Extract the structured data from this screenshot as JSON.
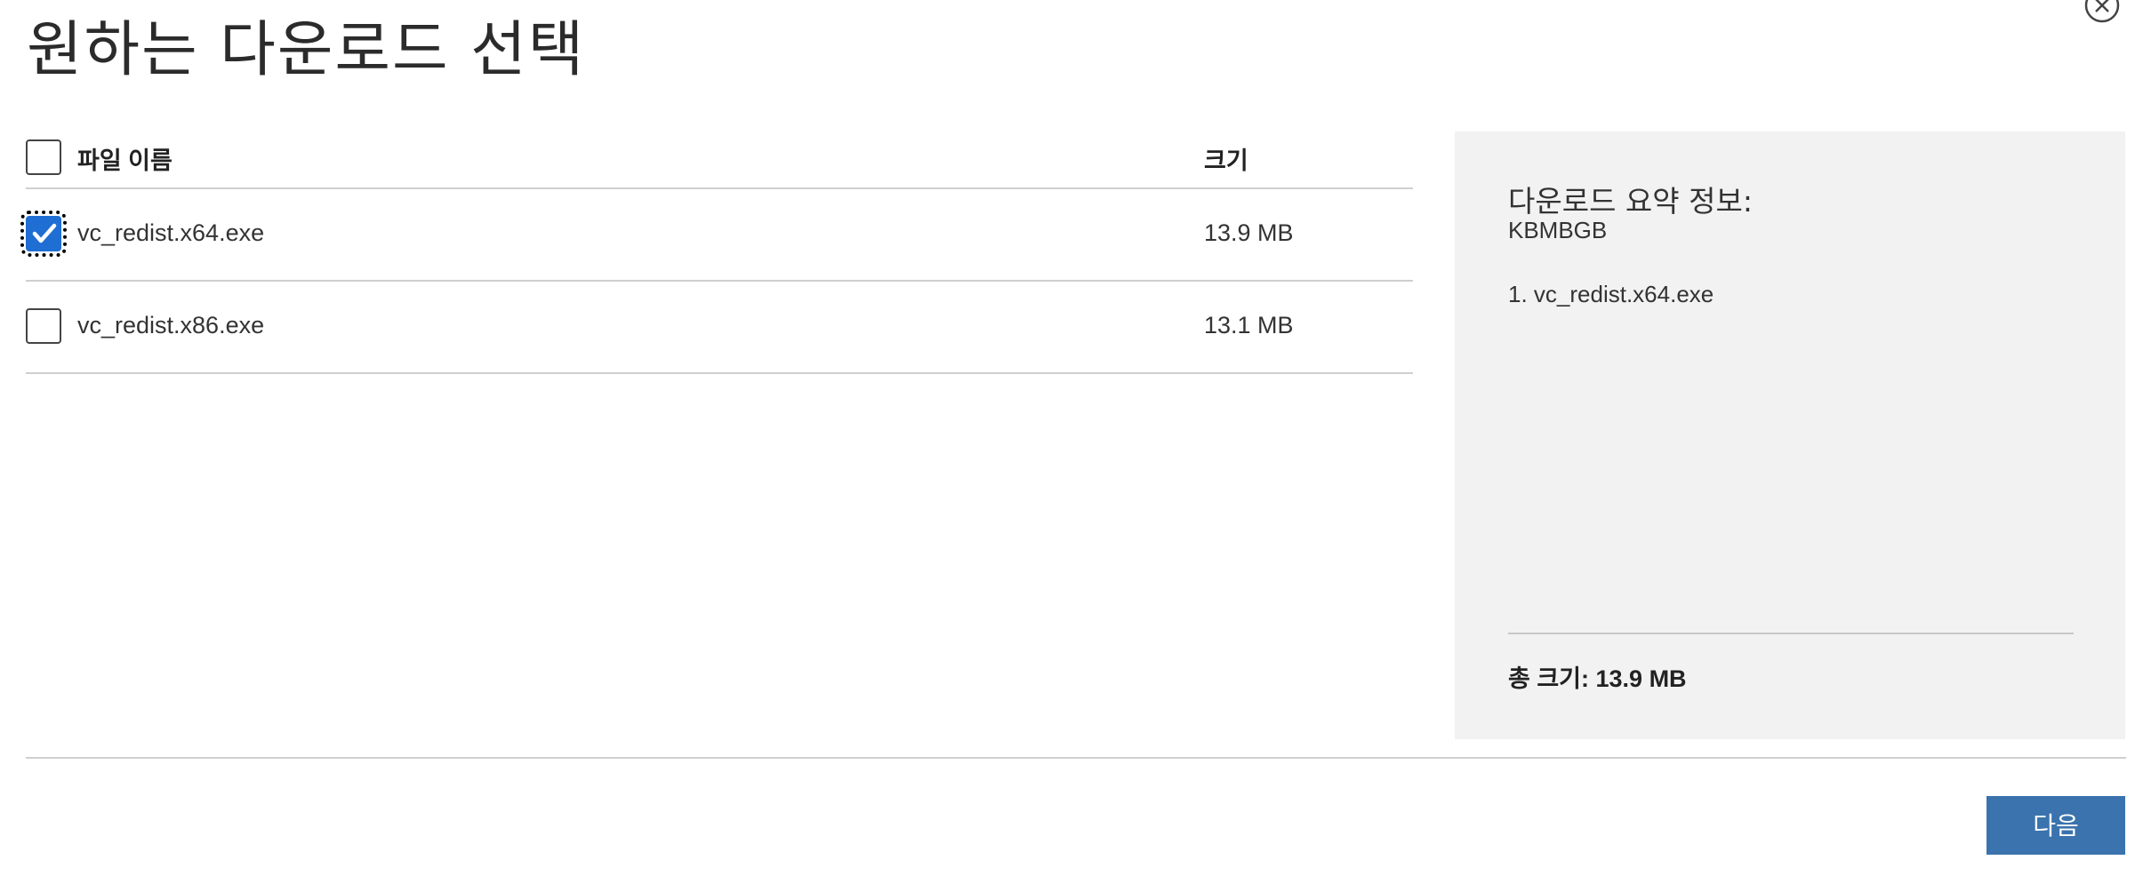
{
  "dialog": {
    "title": "원하는 다운로드 선택",
    "close_icon": "close-circle-icon"
  },
  "file_table": {
    "headers": {
      "name": "파일 이름",
      "size": "크기"
    },
    "select_all_checked": false,
    "rows": [
      {
        "name": "vc_redist.x64.exe",
        "size": "13.9 MB",
        "checked": true
      },
      {
        "name": "vc_redist.x86.exe",
        "size": "13.1 MB",
        "checked": false
      }
    ]
  },
  "summary": {
    "title": "다운로드 요약 정보:",
    "kb": "KBMBGB",
    "selected_items": [
      "1. vc_redist.x64.exe"
    ],
    "total": "총 크기: 13.9 MB"
  },
  "footer": {
    "next_label": "다음"
  },
  "colors": {
    "accent": "#3a73ad",
    "checkbox_checked": "#1f6ed4",
    "summary_bg": "#f2f2f2",
    "divider": "#cfcfcf"
  }
}
